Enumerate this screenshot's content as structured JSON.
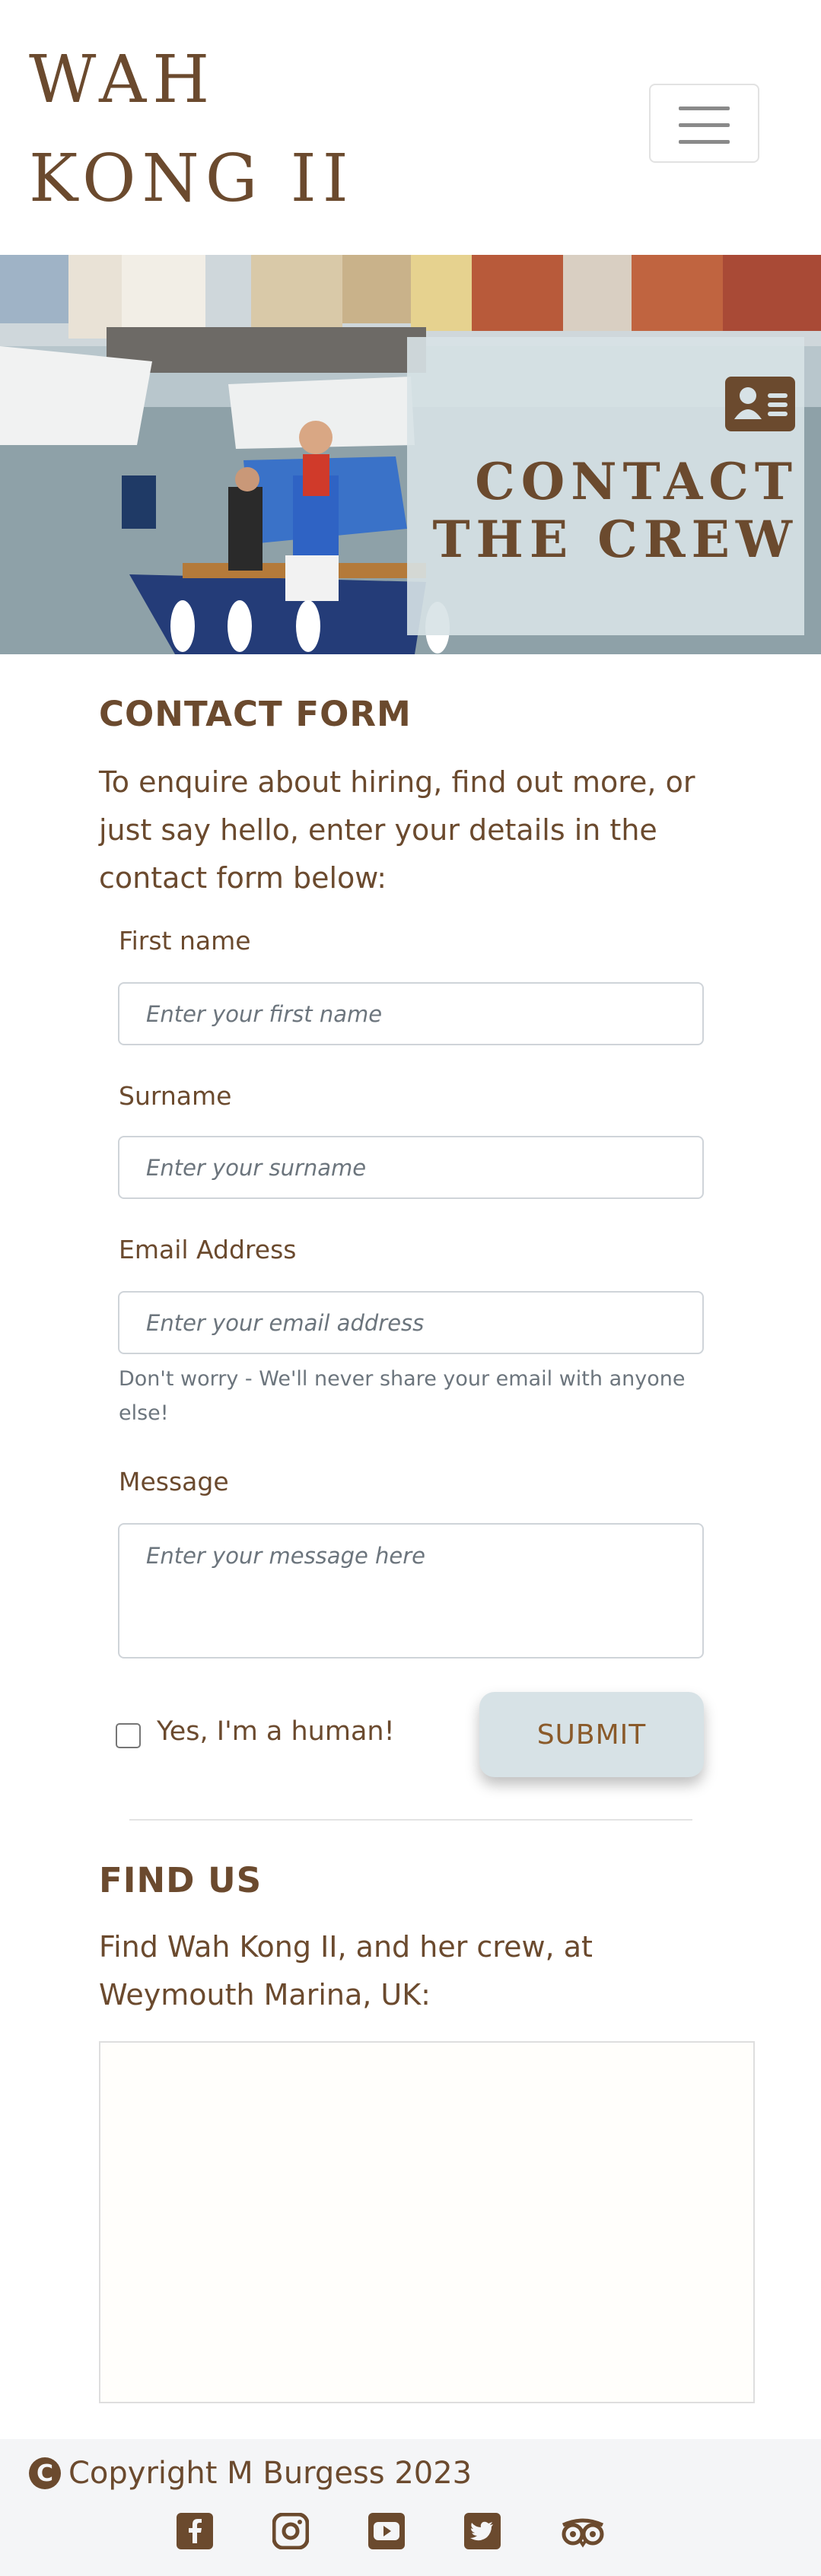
{
  "nav": {
    "brand_line1": "WAH",
    "brand_line2": "KONG II",
    "toggle_icon": "hamburger-icon"
  },
  "hero": {
    "title_line1": "CONTACT",
    "title_line2": "THE CREW",
    "icon": "address-card-icon"
  },
  "contact": {
    "heading": "CONTACT FORM",
    "intro_line1": "To enquire about hiring, find out more, or",
    "intro_line2": "just say hello, enter your details in the",
    "intro_line3": "contact form below:",
    "first_name": {
      "label": "First name",
      "placeholder": "Enter your first name"
    },
    "surname": {
      "label": "Surname",
      "placeholder": "Enter your surname"
    },
    "email": {
      "label": "Email Address",
      "placeholder": "Enter your email address",
      "help_line1": "Don't worry - We'll never share your email with anyone",
      "help_line2": "else!"
    },
    "message": {
      "label": "Message",
      "placeholder": "Enter your message here"
    },
    "human_check": {
      "label": "Yes, I'm a human!",
      "checked": false
    },
    "submit_label": "SUBMIT"
  },
  "find_us": {
    "heading": "FIND US",
    "text_line1": "Find Wah Kong II, and her crew, at",
    "text_line2": "Weymouth Marina, UK:"
  },
  "footer": {
    "copyright": "Copyright M Burgess 2023",
    "copyright_icon": "copyright-icon",
    "social": [
      "facebook-icon",
      "instagram-icon",
      "youtube-icon",
      "twitter-icon",
      "tripadvisor-icon"
    ]
  },
  "colors": {
    "brand_brown": "#6b4a2e",
    "panel_blue": "#d7e2e6",
    "muted_text": "#6c757d",
    "footer_bg": "#f4f5f7"
  }
}
